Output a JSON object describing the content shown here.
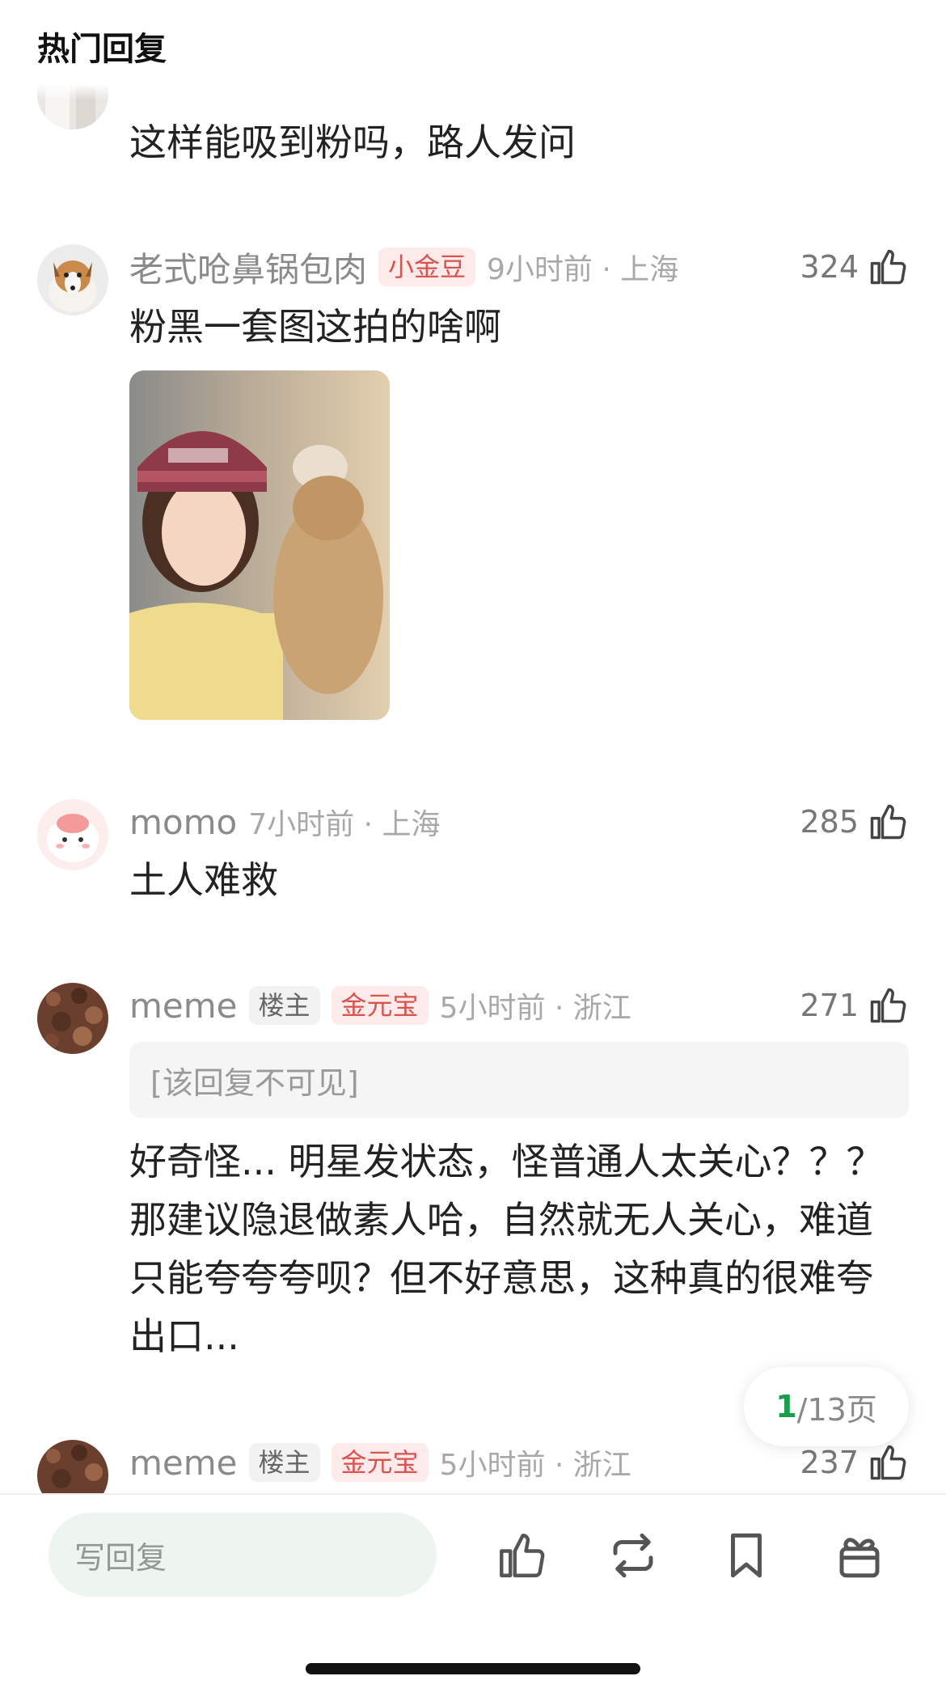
{
  "header": {
    "title": "热门回复"
  },
  "comments": [
    {
      "text": "这样能吸到粉吗，路人发问"
    },
    {
      "username": "老式呛鼻锅包肉",
      "badge": "小金豆",
      "time_loc": "9小时前 · 上海",
      "likes": "324",
      "text": "粉黑一套图这拍的啥啊"
    },
    {
      "username": "momo",
      "time_loc": "7小时前 · 上海",
      "likes": "285",
      "text": "土人难救"
    },
    {
      "username": "meme",
      "owner_badge": "楼主",
      "badge": "金元宝",
      "time_loc": "5小时前 · 浙江",
      "likes": "271",
      "hidden_reply": "[该回复不可见]",
      "text": "好奇怪... 明星发状态，怪普通人太关心？？？ 那建议隐退做素人哈，自然就无人关心，难道只能夸夸夸呗？但不好意思，这种真的很难夸出口..."
    },
    {
      "username": "meme",
      "owner_badge": "楼主",
      "badge": "金元宝",
      "time_loc": "5小时前 · 浙江",
      "likes": "237"
    }
  ],
  "pager": {
    "current": "1",
    "total": "/13页"
  },
  "bottom": {
    "reply_placeholder": "写回复",
    "actions": [
      "thumbs-up-icon",
      "repost-icon",
      "bookmark-icon",
      "gift-icon"
    ]
  },
  "colors": {
    "accent_green": "#1a9e4b",
    "badge_red": "#d9534f",
    "input_bg": "#eef4f0"
  }
}
